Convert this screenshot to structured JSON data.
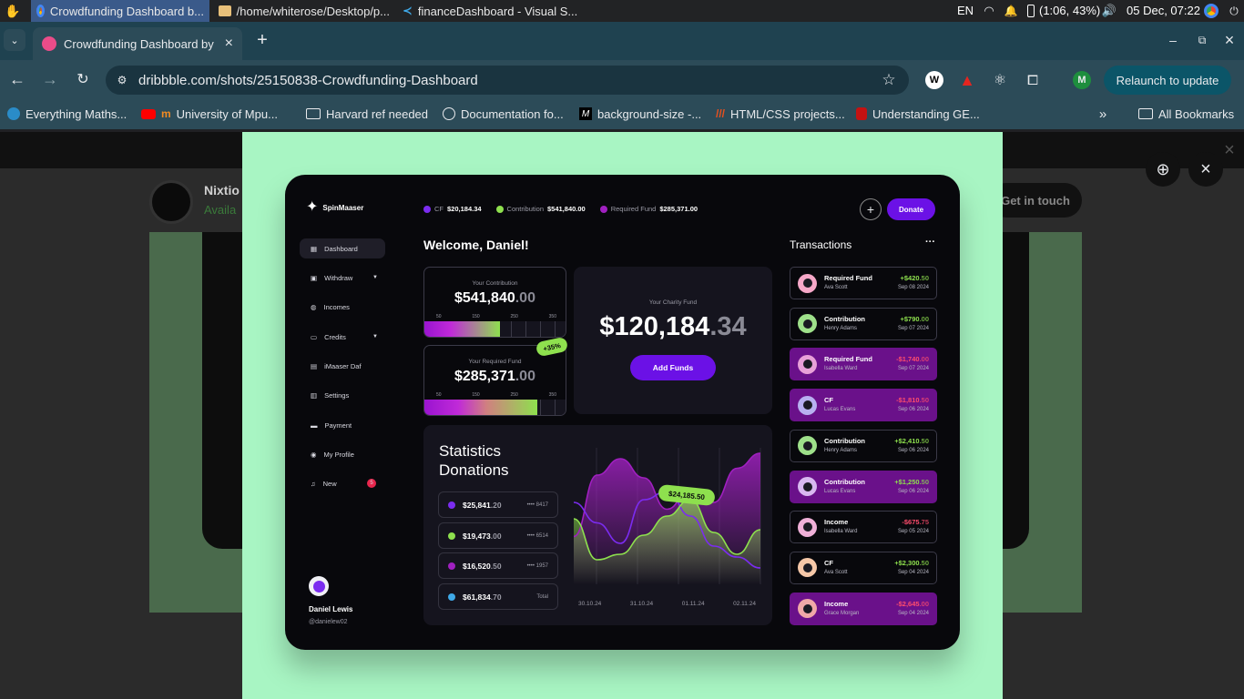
{
  "taskbar": {
    "tasks": [
      {
        "label": "Crowdfunding Dashboard b..."
      },
      {
        "label": "/home/whiterose/Desktop/p..."
      },
      {
        "label": "financeDashboard - Visual S..."
      }
    ],
    "lang": "EN",
    "battery": "(1:06, 43%)",
    "datetime": "05 Dec, 07:22"
  },
  "browser": {
    "tab_title": "Crowdfunding Dashboard by",
    "url": "dribbble.com/shots/25150838-Crowdfunding-Dashboard",
    "profile_initial": "M",
    "relaunch_label": "Relaunch to update",
    "bookmarks": [
      {
        "label": "Everything Maths..."
      },
      {
        "label": "University of Mpu..."
      },
      {
        "label": "Harvard ref needed"
      },
      {
        "label": "Documentation fo..."
      },
      {
        "label": "background-size -..."
      },
      {
        "label": "HTML/CSS projects..."
      },
      {
        "label": "Understanding GE..."
      }
    ],
    "all_bookmarks": "All Bookmarks"
  },
  "underlay": {
    "author": "Nixtio",
    "availability": "Availa",
    "cta": "Get in touch"
  },
  "dashboard": {
    "brand": "SpinMaaser",
    "top_stats": [
      {
        "label": "CF",
        "value": "$20,184.34",
        "color": "#7b2cf0"
      },
      {
        "label": "Contribution",
        "value": "$541,840.00",
        "color": "#8ee04e"
      },
      {
        "label": "Required Fund",
        "value": "$285,371.00",
        "color": "#a020c0"
      }
    ],
    "donate_label": "Donate",
    "nav": [
      {
        "label": "Dashboard",
        "icon": "grid-icon",
        "active": true
      },
      {
        "label": "Withdraw",
        "icon": "wallet-icon",
        "chevron": true
      },
      {
        "label": "Incomes",
        "icon": "coins-icon"
      },
      {
        "label": "Credits",
        "icon": "card-icon",
        "chevron": true
      },
      {
        "label": "iMaaser Daf",
        "icon": "book-icon"
      },
      {
        "label": "Settings",
        "icon": "sliders-icon"
      },
      {
        "label": "Payment",
        "icon": "payment-icon"
      },
      {
        "label": "My Profile",
        "icon": "profile-icon"
      },
      {
        "label": "New",
        "icon": "bell-icon",
        "badge": "5"
      }
    ],
    "user": {
      "name": "Daniel Lewis",
      "handle": "@danielew02"
    },
    "welcome": "Welcome, Daniel!",
    "contribution": {
      "caption": "Your Contribution",
      "main": "$541,840",
      "dec": ".00",
      "ticks": [
        "50",
        "150",
        "250",
        "350"
      ],
      "progress": 0.53
    },
    "required": {
      "caption": "Your Required Fund",
      "main": "$285,371",
      "dec": ".00",
      "ticks": [
        "50",
        "150",
        "250",
        "350"
      ],
      "progress": 0.79,
      "badge": "+35%"
    },
    "charity": {
      "caption": "Your Charity Fund",
      "main": "$120,184",
      "dec": ".34",
      "button": "Add Funds"
    },
    "stats": {
      "title_line1": "Statistics",
      "title_line2": "Donations",
      "rows": [
        {
          "main": "$25,841",
          "dec": ".20",
          "meta": "•••• 8417",
          "color": "#7b2cf0"
        },
        {
          "main": "$19,473",
          "dec": ".00",
          "meta": "•••• 6514",
          "color": "#8ee04e"
        },
        {
          "main": "$16,520",
          "dec": ".50",
          "meta": "•••• 1957",
          "color": "#a020c0"
        },
        {
          "main": "$61,834",
          "dec": ".70",
          "meta": "Total",
          "color": "#3fa9e8"
        }
      ],
      "tooltip": "$24,185.50"
    },
    "chart_data": {
      "type": "area",
      "categories": [
        "30.10.24",
        "31.10.24",
        "01.11.24",
        "02.11.24"
      ],
      "series": [
        {
          "color": "#a020c0",
          "values": [
            35,
            80,
            92,
            78,
            55,
            70,
            60,
            85,
            96
          ]
        },
        {
          "color": "#7b2cf0",
          "values": [
            60,
            45,
            30,
            62,
            68,
            50,
            28,
            20,
            12
          ]
        },
        {
          "color": "#8ee04e",
          "values": [
            48,
            18,
            22,
            36,
            50,
            62,
            38,
            22,
            40
          ]
        }
      ]
    },
    "transactions_title": "Transactions",
    "transactions": [
      {
        "title": "Required Fund",
        "name": "Ava Scott",
        "amount": "+$420",
        "dec": ".50",
        "date": "Sep 08 2024",
        "positive": true,
        "highlight": false
      },
      {
        "title": "Contribution",
        "name": "Henry Adams",
        "amount": "+$790",
        "dec": ".00",
        "date": "Sep 07 2024",
        "positive": true,
        "highlight": false
      },
      {
        "title": "Required Fund",
        "name": "Isabella Ward",
        "amount": "-$1,740",
        "dec": ".00",
        "date": "Sep 07 2024",
        "positive": false,
        "highlight": true
      },
      {
        "title": "CF",
        "name": "Lucas Evans",
        "amount": "-$1,810",
        "dec": ".50",
        "date": "Sep 06 2024",
        "positive": false,
        "highlight": true
      },
      {
        "title": "Contribution",
        "name": "Henry Adams",
        "amount": "+$2,410",
        "dec": ".50",
        "date": "Sep 06 2024",
        "positive": true,
        "highlight": false
      },
      {
        "title": "Contribution",
        "name": "Lucas Evans",
        "amount": "+$1,250",
        "dec": ".50",
        "date": "Sep 06 2024",
        "positive": true,
        "highlight": true
      },
      {
        "title": "Income",
        "name": "Isabella Ward",
        "amount": "-$675",
        "dec": ".75",
        "date": "Sep 05 2024",
        "positive": false,
        "highlight": false
      },
      {
        "title": "CF",
        "name": "Ava Scott",
        "amount": "+$2,300",
        "dec": ".50",
        "date": "Sep 04 2024",
        "positive": true,
        "highlight": false
      },
      {
        "title": "Income",
        "name": "Grace Morgan",
        "amount": "-$2,645",
        "dec": ".00",
        "date": "Sep 04 2024",
        "positive": false,
        "highlight": true
      }
    ]
  }
}
